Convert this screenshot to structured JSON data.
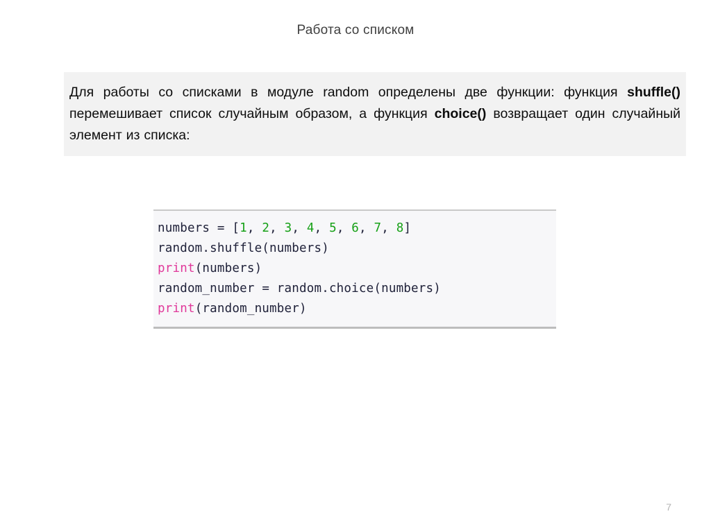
{
  "slide": {
    "title": "Работа со списком",
    "page_number": "7",
    "background_color": "#ffffff"
  },
  "paragraph": {
    "background_color": "#f2f2f2",
    "segment_1": "Для работы со списками в модуле random определены две функции: функция ",
    "bold_1": "shuffle()",
    "segment_2": " перемешивает список случайным образом, а функция ",
    "bold_2": "choice()",
    "segment_3": " возвращает один случайный элемент из списка:"
  },
  "code_block": {
    "background_color": "#f7f7f9",
    "border_color": "#c9c9c9",
    "language": "python",
    "number_color": "#16a016",
    "builtin_color": "#e0389a",
    "plain_color": "#20223a",
    "lines": [
      {
        "tokens": [
          {
            "text": "numbers ",
            "type": "name"
          },
          {
            "text": "= ",
            "type": "op"
          },
          {
            "text": "[",
            "type": "punct"
          },
          {
            "text": "1",
            "type": "num"
          },
          {
            "text": ", ",
            "type": "punct"
          },
          {
            "text": "2",
            "type": "num"
          },
          {
            "text": ", ",
            "type": "punct"
          },
          {
            "text": "3",
            "type": "num"
          },
          {
            "text": ", ",
            "type": "punct"
          },
          {
            "text": "4",
            "type": "num"
          },
          {
            "text": ", ",
            "type": "punct"
          },
          {
            "text": "5",
            "type": "num"
          },
          {
            "text": ", ",
            "type": "punct"
          },
          {
            "text": "6",
            "type": "num"
          },
          {
            "text": ", ",
            "type": "punct"
          },
          {
            "text": "7",
            "type": "num"
          },
          {
            "text": ", ",
            "type": "punct"
          },
          {
            "text": "8",
            "type": "num"
          },
          {
            "text": "]",
            "type": "punct"
          }
        ]
      },
      {
        "tokens": [
          {
            "text": "random.shuffle(numbers)",
            "type": "name"
          }
        ]
      },
      {
        "tokens": [
          {
            "text": "print",
            "type": "builtin"
          },
          {
            "text": "(numbers)",
            "type": "name"
          }
        ]
      },
      {
        "tokens": [
          {
            "text": "random_number ",
            "type": "name"
          },
          {
            "text": "= ",
            "type": "op"
          },
          {
            "text": "random.choice(numbers)",
            "type": "name"
          }
        ]
      },
      {
        "tokens": [
          {
            "text": "print",
            "type": "builtin"
          },
          {
            "text": "(random_number)",
            "type": "name"
          }
        ]
      }
    ]
  }
}
